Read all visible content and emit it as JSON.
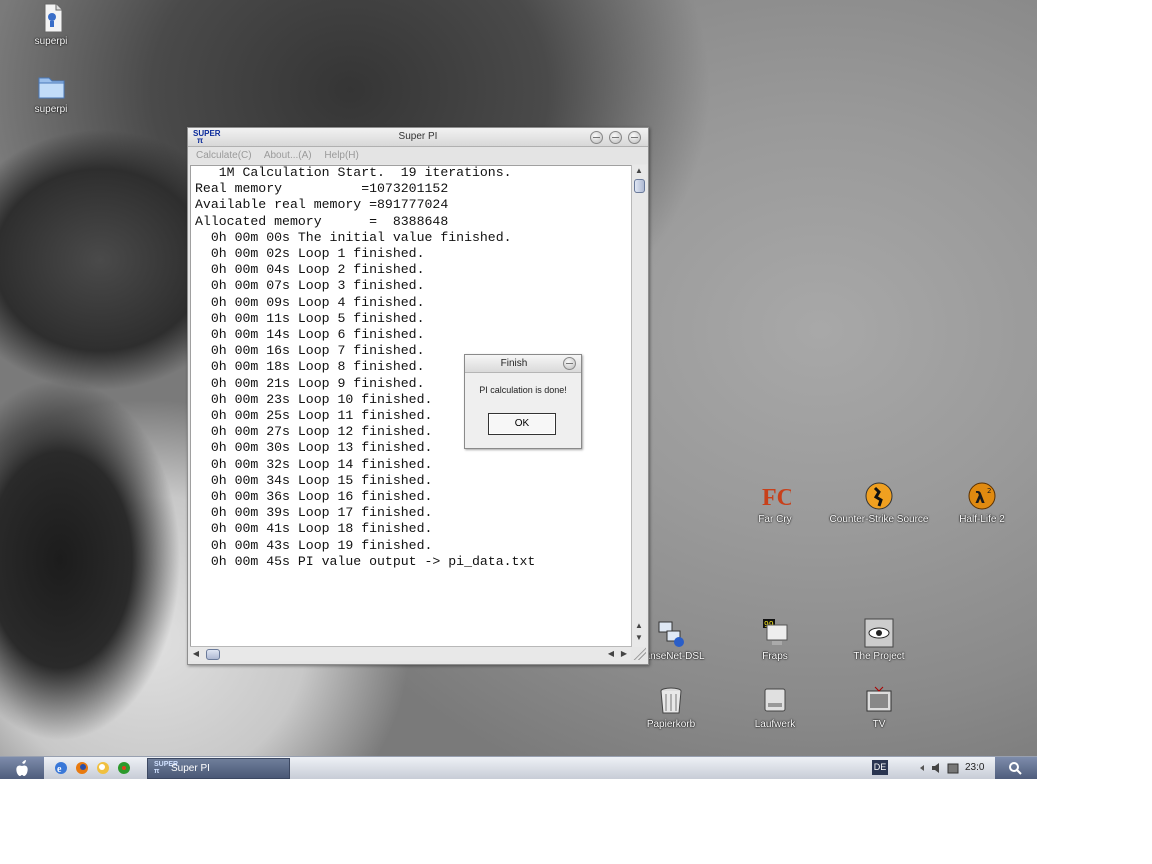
{
  "desktop": {
    "top_left_icons": [
      {
        "label": "superpi",
        "icon": "zip-archive-icon"
      },
      {
        "label": "superpi",
        "icon": "folder-icon"
      }
    ],
    "icons": [
      {
        "label": "Far Cry",
        "icon": "farcry-icon"
      },
      {
        "label": "Counter-Strike Source",
        "icon": "counter-strike-icon"
      },
      {
        "label": "Half-Life 2",
        "icon": "half-life-icon"
      },
      {
        "label": "HanseNet-DSL",
        "icon": "network-icon"
      },
      {
        "label": "Fraps",
        "icon": "fraps-icon"
      },
      {
        "label": "The Project",
        "icon": "the-project-icon"
      },
      {
        "label": "Papierkorb",
        "icon": "trash-icon"
      },
      {
        "label": "Laufwerk",
        "icon": "drive-icon"
      },
      {
        "label": "TV",
        "icon": "tv-icon"
      }
    ]
  },
  "superpi": {
    "title": "Super PI",
    "menu": [
      "Calculate(C)",
      "About...(A)",
      "Help(H)"
    ],
    "log": [
      "   1M Calculation Start.  19 iterations.",
      "Real memory          =1073201152",
      "Available real memory =891777024",
      "Allocated memory      =  8388648",
      "  0h 00m 00s The initial value finished.",
      "  0h 00m 02s Loop 1 finished.",
      "  0h 00m 04s Loop 2 finished.",
      "  0h 00m 07s Loop 3 finished.",
      "  0h 00m 09s Loop 4 finished.",
      "  0h 00m 11s Loop 5 finished.",
      "  0h 00m 14s Loop 6 finished.",
      "  0h 00m 16s Loop 7 finished.",
      "  0h 00m 18s Loop 8 finished.",
      "  0h 00m 21s Loop 9 finished.",
      "  0h 00m 23s Loop 10 finished.",
      "  0h 00m 25s Loop 11 finished.",
      "  0h 00m 27s Loop 12 finished.",
      "  0h 00m 30s Loop 13 finished.",
      "  0h 00m 32s Loop 14 finished.",
      "  0h 00m 34s Loop 15 finished.",
      "  0h 00m 36s Loop 16 finished.",
      "  0h 00m 39s Loop 17 finished.",
      "  0h 00m 41s Loop 18 finished.",
      "  0h 00m 43s Loop 19 finished.",
      "  0h 00m 45s PI value output -> pi_data.txt"
    ]
  },
  "finish_dialog": {
    "title": "Finish",
    "message": "PI calculation is done!",
    "ok_label": "OK"
  },
  "taskbar": {
    "task_label": "Super PI",
    "language": "DE",
    "clock": "23:0"
  }
}
